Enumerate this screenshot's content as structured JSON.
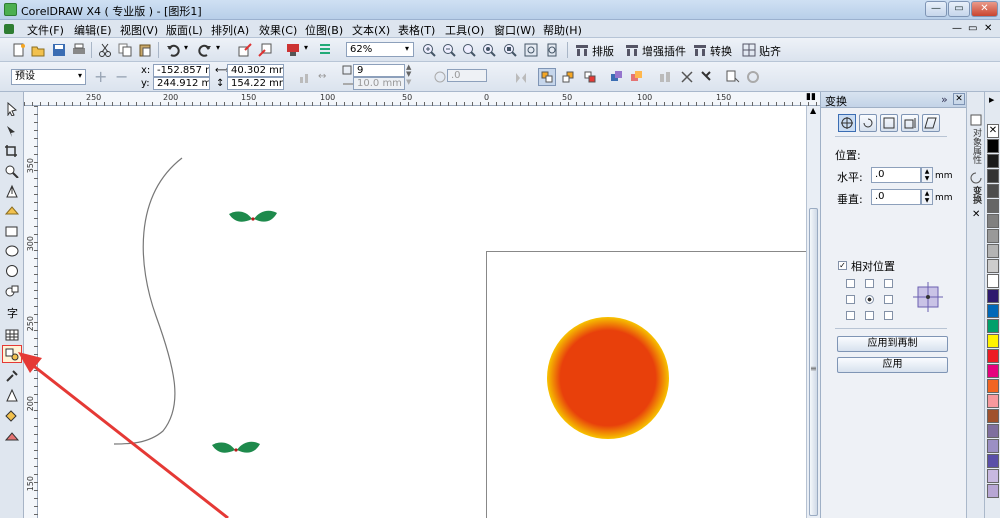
{
  "window": {
    "title": "CorelDRAW X4 ( 专业版 ) - [图形1]",
    "min_label": "—",
    "max_label": "▭",
    "close_label": "✕"
  },
  "menu": [
    "文件(F)",
    "编辑(E)",
    "视图(V)",
    "版面(L)",
    "排列(A)",
    "效果(C)",
    "位图(B)",
    "文本(X)",
    "表格(T)",
    "工具(O)",
    "窗口(W)",
    "帮助(H)"
  ],
  "toolbar1": {
    "zoom": "62%",
    "arrange": "排版",
    "plugins": "增强插件",
    "convert": "转换",
    "paste": "贴齐"
  },
  "toolbar2": {
    "preset": "预设",
    "x_label": "x:",
    "x_value": "-152.857 mm",
    "y_label": "y:",
    "y_value": "244.912 mm",
    "width_value": "40.302 mm",
    "height_value": "154.22 mm",
    "nudge_value": "9",
    "outline_value": "10.0 mm",
    "angle_value": ".0"
  },
  "ruler_top": [
    "250",
    "200",
    "150",
    "100",
    "50",
    "0",
    "50",
    "100",
    "150"
  ],
  "ruler_left": [
    "350",
    "300",
    "250",
    "200",
    "150"
  ],
  "docker": {
    "title": "变换",
    "position_label": "位置:",
    "horizontal_label": "水平:",
    "horizontal_value": ".0",
    "vertical_label": "垂直:",
    "vertical_value": ".0",
    "unit": "mm",
    "relative_label": "相对位置",
    "apply_copy_label": "应用到再制",
    "apply_label": "应用"
  },
  "tabs": {
    "object_props": "对象属性",
    "transform": "变换"
  },
  "palette": [
    "#000000",
    "#1a1a1a",
    "#333333",
    "#4d4d4d",
    "#666666",
    "#808080",
    "#999999",
    "#b3b3b3",
    "#cccccc",
    "#ffffff",
    "#2e1a6e",
    "#0068b8",
    "#00a06b",
    "#fff200",
    "#ed1c24",
    "#e6007e",
    "#f26522",
    "#f6989d",
    "#a0522d",
    "#7f6f9e",
    "#9b8fc4",
    "#5a4fa8",
    "#c7b8e0",
    "#b7a6d4"
  ],
  "colors": {
    "sun_outer": "#f7c300",
    "sun_inner": "#e8400b",
    "leaf": "#1e8a4c",
    "arrow": "#e53935"
  }
}
